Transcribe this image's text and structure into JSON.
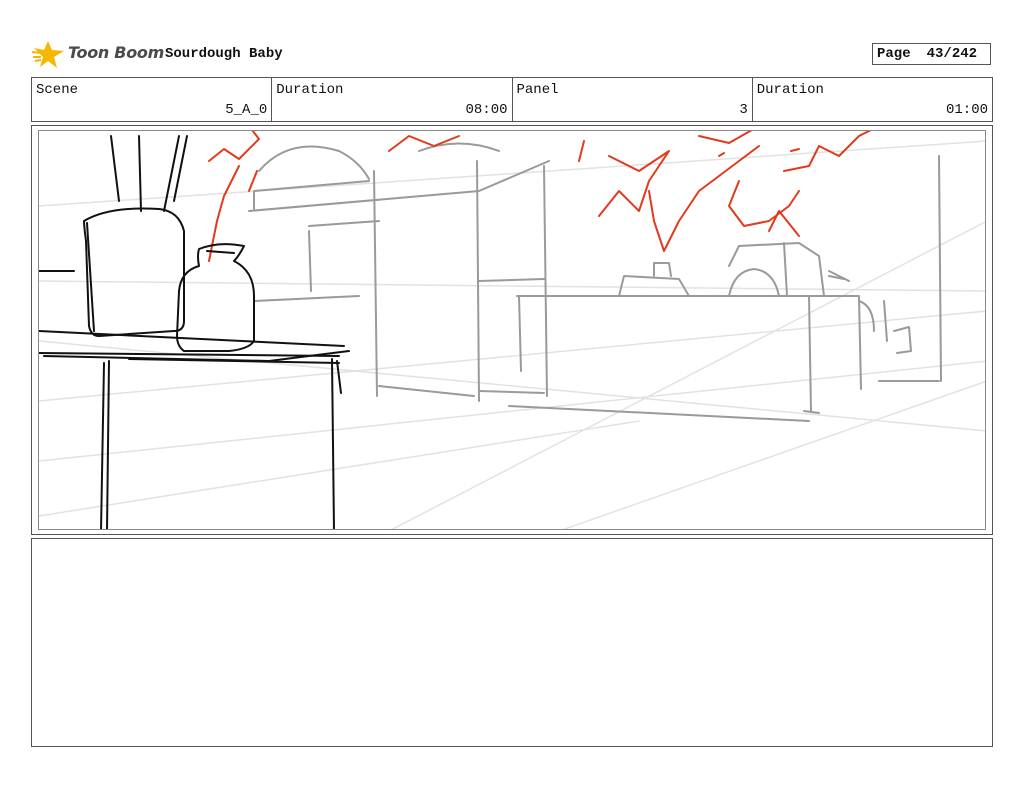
{
  "header": {
    "logo_text": "Toon Boom",
    "project_title": "Sourdough Baby",
    "page_label": "Page",
    "page_number": "43/242"
  },
  "info": {
    "scene_label": "Scene",
    "scene_value": "5_A_0",
    "duration_label": "Duration",
    "duration_value": "08:00",
    "panel_label": "Panel",
    "panel_value": "3",
    "panel_duration_label": "Duration",
    "panel_duration_value": "01:00"
  },
  "colors": {
    "logo_star": "#f5b800",
    "sketch_black": "#111111",
    "sketch_gray": "#9a9a9a",
    "sketch_light": "#e2e2e2",
    "sketch_red": "#e23a1c"
  },
  "notes": {
    "text": ""
  }
}
